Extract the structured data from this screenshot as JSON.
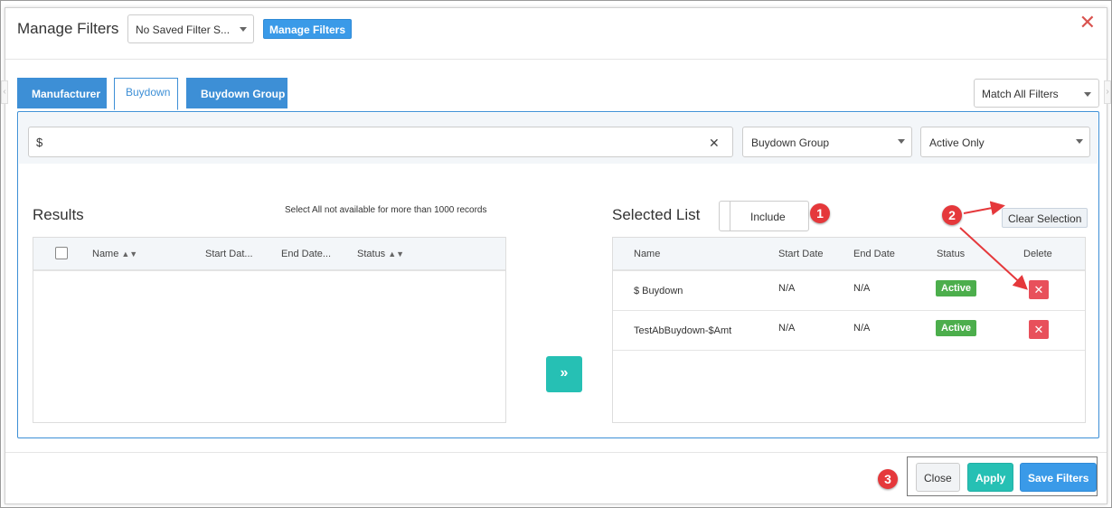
{
  "header": {
    "title": "Manage Filters",
    "saved_filter_value": "No Saved Filter S...",
    "manage_button": "Manage Filters"
  },
  "tabs": [
    {
      "label": "Manufacturer",
      "active": false
    },
    {
      "label": "Buydown",
      "active": true
    },
    {
      "label": "Buydown Group",
      "active": false
    }
  ],
  "match_select": "Match All Filters",
  "filter_bar": {
    "search_value": "$",
    "group_select": "Buydown Group",
    "status_select": "Active Only"
  },
  "results": {
    "title": "Results",
    "note": "Select All not available for more than 1000 records",
    "columns": [
      "Name",
      "Start Dat...",
      "End Date...",
      "Status"
    ]
  },
  "selected": {
    "title": "Selected List",
    "include_label": "Include",
    "clear_button": "Clear Selection",
    "columns": [
      "Name",
      "Start Date",
      "End Date",
      "Status",
      "Delete"
    ],
    "rows": [
      {
        "name": "$ Buydown",
        "start": "N/A",
        "end": "N/A",
        "status": "Active"
      },
      {
        "name": "TestAbBuydown-$Amt",
        "start": "N/A",
        "end": "N/A",
        "status": "Active"
      }
    ]
  },
  "footer": {
    "close": "Close",
    "apply": "Apply",
    "save": "Save Filters"
  },
  "markers": [
    "1",
    "2",
    "3"
  ],
  "colors": {
    "primary": "#3a9ae8",
    "teal": "#26c0b4",
    "active_badge": "#4cae4c",
    "danger": "#e8505b",
    "marker": "#e5383b"
  }
}
